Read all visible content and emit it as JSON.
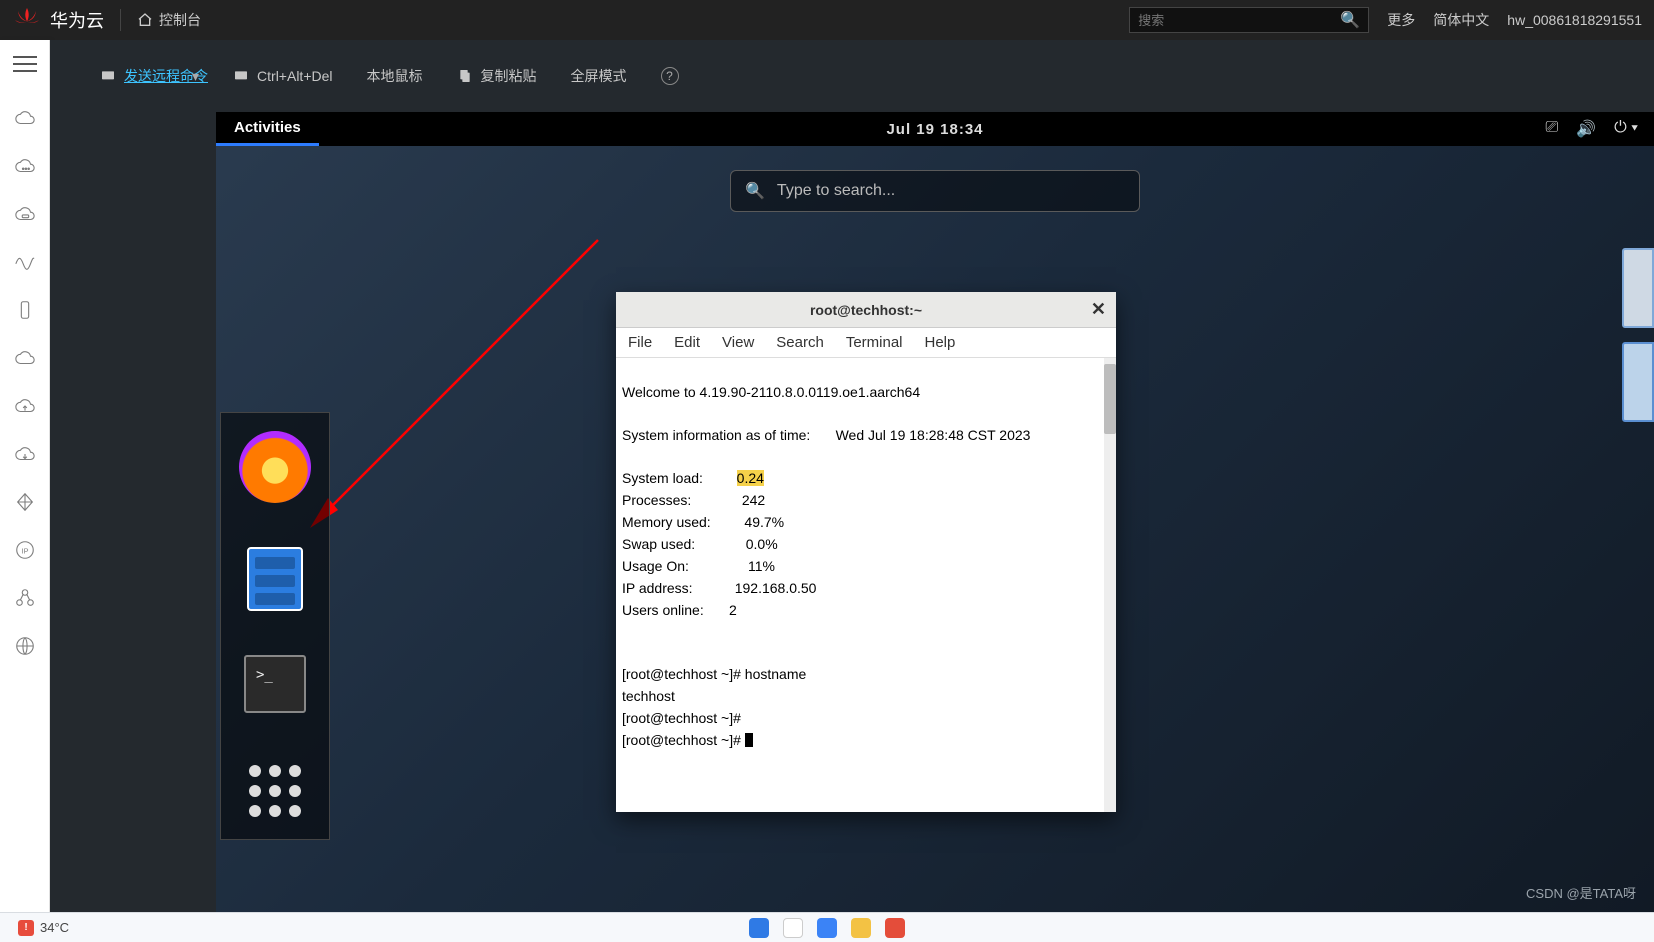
{
  "topbar": {
    "brand": "华为云",
    "console": "控制台",
    "search_placeholder": "搜索",
    "more": "更多",
    "lang": "简体中文",
    "user": "hw_00861818291551"
  },
  "actionbar": {
    "send_cmd": "发送远程命令",
    "ctrl_alt_del": "Ctrl+Alt+Del",
    "local_mouse": "本地鼠标",
    "copy_paste": "复制粘贴",
    "fullscreen": "全屏模式"
  },
  "gnome": {
    "activities": "Activities",
    "clock": "Jul 19  18:34",
    "search_placeholder": "Type to search..."
  },
  "terminal": {
    "title": "root@techhost:~",
    "menu": {
      "file": "File",
      "edit": "Edit",
      "view": "View",
      "search": "Search",
      "terminal": "Terminal",
      "help": "Help"
    },
    "welcome": "Welcome to 4.19.90-2110.8.0.0119.oe1.aarch64",
    "sysinfo_label": "System information as of time:",
    "sysinfo_time": "Wed Jul 19 18:28:48 CST 2023",
    "rows": {
      "system_load": {
        "k": "System load:",
        "v": "0.24"
      },
      "processes": {
        "k": "Processes:",
        "v": "242"
      },
      "memory_used": {
        "k": "Memory used:",
        "v": "49.7%"
      },
      "swap_used": {
        "k": "Swap used:",
        "v": "0.0%"
      },
      "usage_on": {
        "k": "Usage On:",
        "v": "11%"
      },
      "ip_address": {
        "k": "IP address:",
        "v": "192.168.0.50"
      },
      "users_online": {
        "k": "Users online:",
        "v": "2"
      }
    },
    "prompt1": "[root@techhost ~]# hostname",
    "hostname_out": "techhost",
    "prompt2": "[root@techhost ~]#",
    "prompt3": "[root@techhost ~]# "
  },
  "taskbar": {
    "temp": "34°C"
  },
  "watermark": "CSDN @是TATA呀"
}
